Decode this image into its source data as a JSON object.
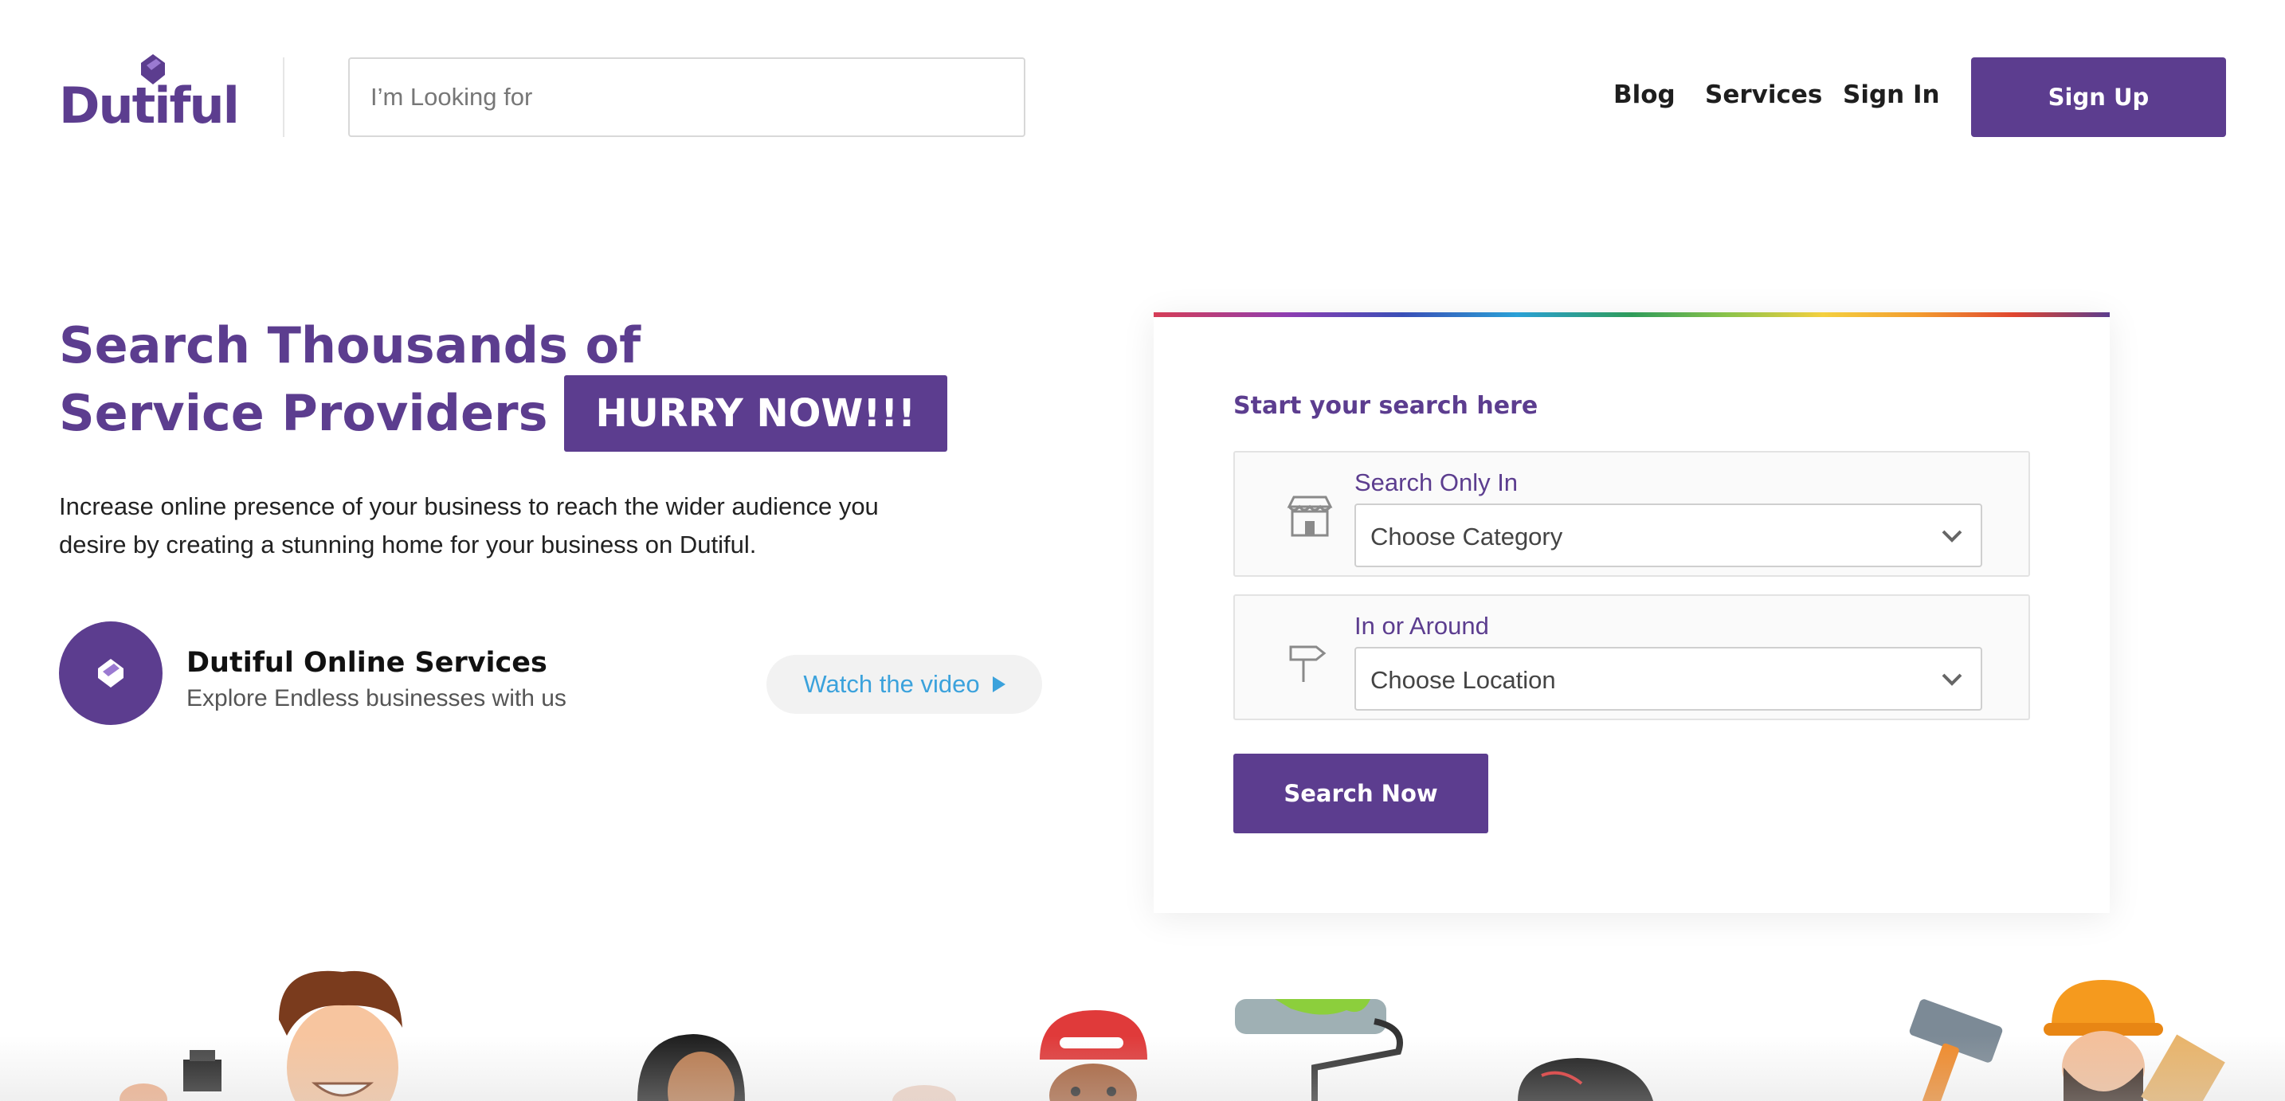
{
  "header": {
    "logo_text": "Dutiful",
    "search_placeholder": "I’m Looking for",
    "nav": {
      "blog": "Blog",
      "services": "Services",
      "sign_in": "Sign In"
    },
    "sign_up": "Sign Up"
  },
  "hero": {
    "title_line1": "Search Thousands of",
    "title_line2": "Service Providers",
    "badge": "HURRY NOW!!!",
    "description": "Increase online presence of your business to reach the wider audience you desire by creating a stunning home for your business on Dutiful.",
    "service_title": "Dutiful Online Services",
    "service_subtitle": "Explore Endless businesses with us",
    "watch_video": "Watch the video"
  },
  "search_card": {
    "heading": "Start your search here",
    "category": {
      "label": "Search Only In",
      "value": "Choose Category",
      "icon": "storefront-icon"
    },
    "location": {
      "label": "In or Around",
      "value": "Choose Location",
      "icon": "signpost-icon"
    },
    "submit": "Search Now"
  },
  "colors": {
    "brand": "#5c3d8f",
    "link": "#3ba2dc",
    "text": "#222222"
  }
}
